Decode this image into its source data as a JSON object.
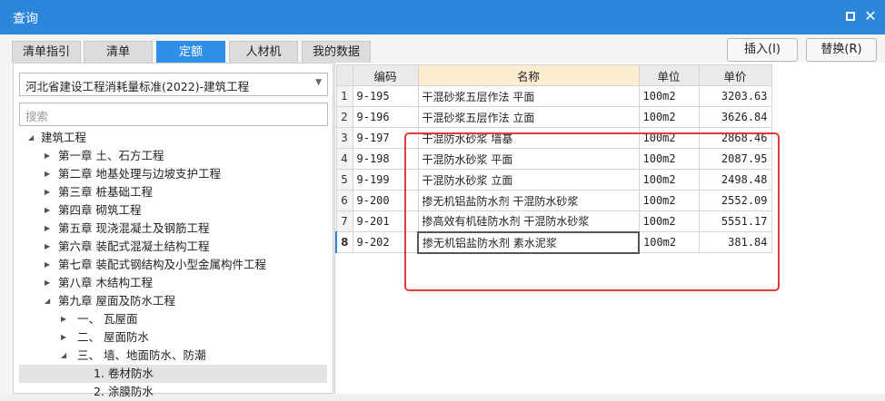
{
  "window": {
    "title": "查询"
  },
  "tabs": [
    {
      "label": "清单指引"
    },
    {
      "label": "清单"
    },
    {
      "label": "定额"
    },
    {
      "label": "人材机"
    },
    {
      "label": "我的数据"
    }
  ],
  "toolbar": {
    "insert_label": "插入(I)",
    "replace_label": "替换(R)"
  },
  "left": {
    "standard_selected": "河北省建设工程消耗量标准(2022)-建筑工程",
    "search_placeholder": "搜索",
    "tree": [
      {
        "label": "建筑工程"
      },
      {
        "label": "第一章 土、石方工程"
      },
      {
        "label": "第二章 地基处理与边坡支护工程"
      },
      {
        "label": "第三章 桩基础工程"
      },
      {
        "label": "第四章 砌筑工程"
      },
      {
        "label": "第五章 现浇混凝土及钢筋工程"
      },
      {
        "label": "第六章 装配式混凝土结构工程"
      },
      {
        "label": "第七章 装配式钢结构及小型金属构件工程"
      },
      {
        "label": "第八章 木结构工程"
      },
      {
        "label": "第九章 屋面及防水工程"
      },
      {
        "label": "一、 瓦屋面"
      },
      {
        "label": "二、 屋面防水"
      },
      {
        "label": "三、 墙、地面防水、防潮"
      },
      {
        "label": "1. 卷材防水"
      },
      {
        "label": "2. 涂膜防水"
      }
    ]
  },
  "grid": {
    "headers": {
      "code": "编码",
      "name": "名称",
      "unit": "单位",
      "price": "单价"
    },
    "rows": [
      {
        "num": "1",
        "code": "9-195",
        "name": "干混砂浆五层作法 平面",
        "unit": "100m2",
        "price": "3203.63"
      },
      {
        "num": "2",
        "code": "9-196",
        "name": "干混砂浆五层作法 立面",
        "unit": "100m2",
        "price": "3626.84"
      },
      {
        "num": "3",
        "code": "9-197",
        "name": "干混防水砂浆 墙基",
        "unit": "100m2",
        "price": "2868.46"
      },
      {
        "num": "4",
        "code": "9-198",
        "name": "干混防水砂浆 平面",
        "unit": "100m2",
        "price": "2087.95"
      },
      {
        "num": "5",
        "code": "9-199",
        "name": "干混防水砂浆 立面",
        "unit": "100m2",
        "price": "2498.48"
      },
      {
        "num": "6",
        "code": "9-200",
        "name": "掺无机铝盐防水剂 干混防水砂浆",
        "unit": "100m2",
        "price": "2552.09"
      },
      {
        "num": "7",
        "code": "9-201",
        "name": "掺高效有机硅防水剂 干混防水砂浆",
        "unit": "100m2",
        "price": "5551.17"
      },
      {
        "num": "8",
        "code": "9-202",
        "name": "掺无机铝盐防水剂 素水泥浆",
        "unit": "100m2",
        "price": "381.84"
      }
    ]
  }
}
